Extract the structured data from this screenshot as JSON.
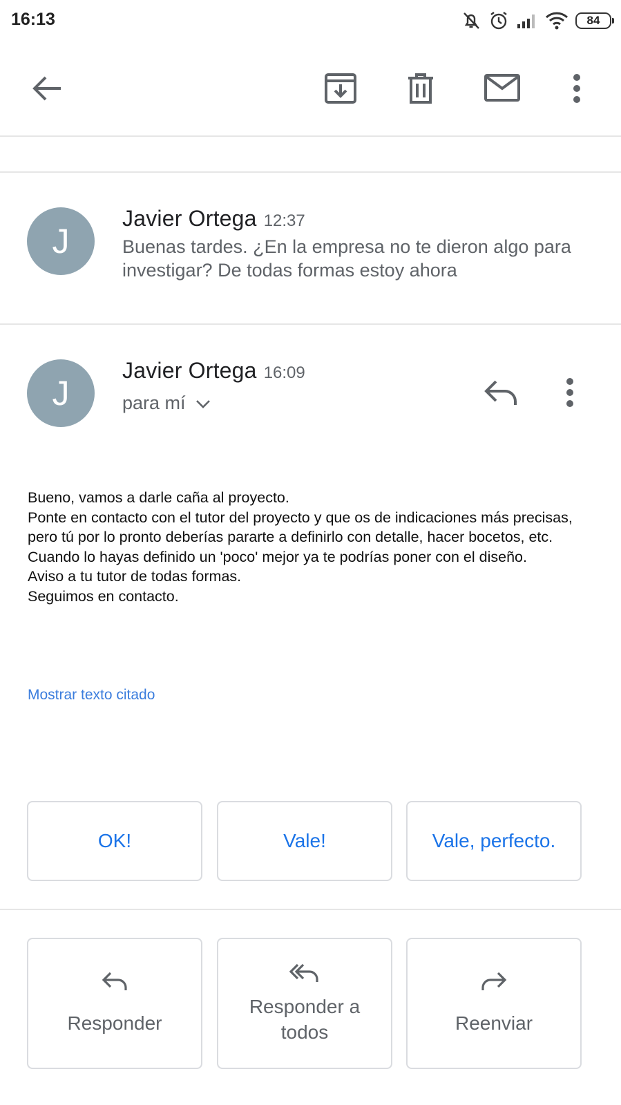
{
  "status_bar": {
    "time": "16:13",
    "battery": "84",
    "icons": [
      "muted-bell-icon",
      "alarm-icon",
      "signal-icon",
      "wifi-icon",
      "battery-icon"
    ]
  },
  "toolbar": {
    "icons": [
      "back-arrow-icon",
      "archive-icon",
      "delete-icon",
      "mail-icon",
      "more-vert-icon"
    ]
  },
  "messages": [
    {
      "sender": "Javier Ortega",
      "time": "12:37",
      "avatar_letter": "J",
      "snippet": "Buenas tardes. ¿En la empresa no te dieron algo para investigar? De todas formas estoy ahora"
    },
    {
      "sender": "Javier Ortega",
      "time": "16:09",
      "avatar_letter": "J",
      "recipient": "para mí",
      "body": "Bueno, vamos a darle caña al proyecto.\nPonte en contacto con el tutor del proyecto y que os de indicaciones más precisas, pero tú por lo pronto deberías pararte a definirlo con detalle, hacer bocetos, etc.\nCuando lo hayas definido un 'poco' mejor ya te podrías poner con el diseño.\nAviso a tu tutor de todas formas.\nSeguimos en contacto.",
      "show_quoted": "Mostrar texto citado"
    }
  ],
  "smart_replies": [
    "OK!",
    "Vale!",
    "Vale, perfecto."
  ],
  "actions": [
    {
      "label": "Responder",
      "icon": "reply-icon"
    },
    {
      "label": "Responder a todos",
      "icon": "reply-all-icon"
    },
    {
      "label": "Reenviar",
      "icon": "forward-icon"
    }
  ],
  "colors": {
    "avatar": "#8fa4b0",
    "link": "#3b7ddd",
    "smart_reply_text": "#1a73e8",
    "icon": "#5f6368"
  }
}
